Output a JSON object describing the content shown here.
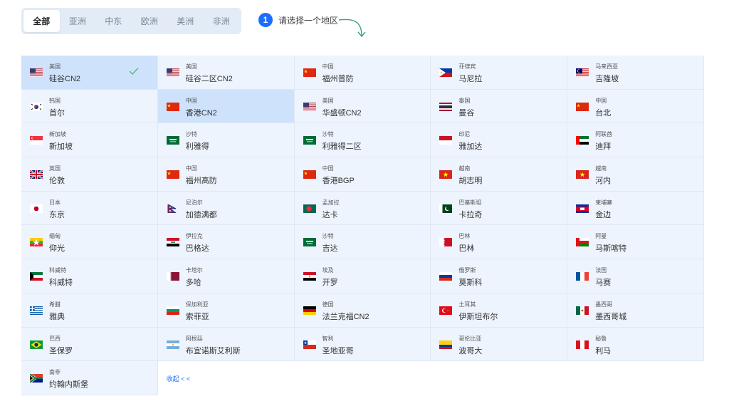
{
  "tabs": [
    "全部",
    "亚洲",
    "中东",
    "欧洲",
    "美洲",
    "非洲"
  ],
  "active_tab": 0,
  "step": {
    "number": "1",
    "text": "请选择一个地区"
  },
  "collapse_label": "收起 < <",
  "colors": {
    "accent": "#1a6dff",
    "cell_bg": "#edf4fd",
    "selected_bg": "#cfe2fb",
    "check": "#52c28a"
  },
  "regions": [
    {
      "country": "美国",
      "city": "硅谷CN2",
      "flag": "us",
      "selected": true
    },
    {
      "country": "美国",
      "city": "硅谷二区CN2",
      "flag": "us"
    },
    {
      "country": "中国",
      "city": "福州普防",
      "flag": "cn"
    },
    {
      "country": "菲律宾",
      "city": "马尼拉",
      "flag": "ph"
    },
    {
      "country": "马来西亚",
      "city": "吉隆坡",
      "flag": "my"
    },
    {
      "country": "韩国",
      "city": "首尔",
      "flag": "kr"
    },
    {
      "country": "中国",
      "city": "香港CN2",
      "flag": "cn",
      "selected": true
    },
    {
      "country": "美国",
      "city": "华盛顿CN2",
      "flag": "us"
    },
    {
      "country": "泰国",
      "city": "曼谷",
      "flag": "th"
    },
    {
      "country": "中国",
      "city": "台北",
      "flag": "cn"
    },
    {
      "country": "新加坡",
      "city": "新加坡",
      "flag": "sg"
    },
    {
      "country": "沙特",
      "city": "利雅得",
      "flag": "sa"
    },
    {
      "country": "沙特",
      "city": "利雅得二区",
      "flag": "sa"
    },
    {
      "country": "印尼",
      "city": "雅加达",
      "flag": "id"
    },
    {
      "country": "阿联酋",
      "city": "迪拜",
      "flag": "ae"
    },
    {
      "country": "英国",
      "city": "伦敦",
      "flag": "gb"
    },
    {
      "country": "中国",
      "city": "福州高防",
      "flag": "cn"
    },
    {
      "country": "中国",
      "city": "香港BGP",
      "flag": "cn"
    },
    {
      "country": "越南",
      "city": "胡志明",
      "flag": "vn"
    },
    {
      "country": "越南",
      "city": "河内",
      "flag": "vn"
    },
    {
      "country": "日本",
      "city": "东京",
      "flag": "jp"
    },
    {
      "country": "尼泊尔",
      "city": "加德满都",
      "flag": "np"
    },
    {
      "country": "孟加拉",
      "city": "达卡",
      "flag": "bd"
    },
    {
      "country": "巴基斯坦",
      "city": "卡拉奇",
      "flag": "pk"
    },
    {
      "country": "柬埔寨",
      "city": "金边",
      "flag": "kh"
    },
    {
      "country": "缅甸",
      "city": "仰光",
      "flag": "mm"
    },
    {
      "country": "伊拉克",
      "city": "巴格达",
      "flag": "iq"
    },
    {
      "country": "沙特",
      "city": "吉达",
      "flag": "sa"
    },
    {
      "country": "巴林",
      "city": "巴林",
      "flag": "bh"
    },
    {
      "country": "阿曼",
      "city": "马斯喀特",
      "flag": "om"
    },
    {
      "country": "科威特",
      "city": "科威特",
      "flag": "kw"
    },
    {
      "country": "卡塔尔",
      "city": "多哈",
      "flag": "qa"
    },
    {
      "country": "埃及",
      "city": "开罗",
      "flag": "eg"
    },
    {
      "country": "俄罗斯",
      "city": "莫斯科",
      "flag": "ru"
    },
    {
      "country": "法国",
      "city": "马赛",
      "flag": "fr"
    },
    {
      "country": "希腊",
      "city": "雅典",
      "flag": "gr"
    },
    {
      "country": "保加利亚",
      "city": "索菲亚",
      "flag": "bg"
    },
    {
      "country": "德国",
      "city": "法兰克福CN2",
      "flag": "de"
    },
    {
      "country": "土耳其",
      "city": "伊斯坦布尔",
      "flag": "tr"
    },
    {
      "country": "墨西哥",
      "city": "墨西哥城",
      "flag": "mx"
    },
    {
      "country": "巴西",
      "city": "圣保罗",
      "flag": "br"
    },
    {
      "country": "阿根廷",
      "city": "布宜诺斯艾利斯",
      "flag": "ar"
    },
    {
      "country": "智利",
      "city": "圣地亚哥",
      "flag": "cl"
    },
    {
      "country": "哥伦比亚",
      "city": "波哥大",
      "flag": "co"
    },
    {
      "country": "秘鲁",
      "city": "利马",
      "flag": "pe"
    },
    {
      "country": "南非",
      "city": "约翰内斯堡",
      "flag": "za"
    }
  ]
}
